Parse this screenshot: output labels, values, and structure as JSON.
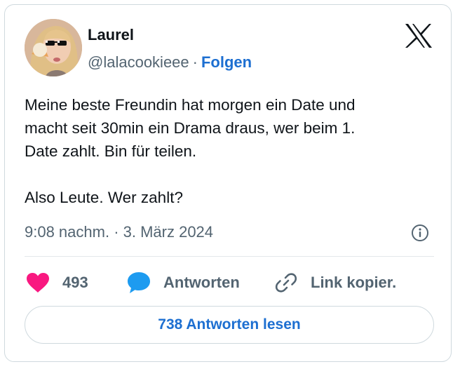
{
  "author": {
    "name": "Laurel",
    "handle": "@lalacookieee",
    "separator": "·",
    "follow_label": "Folgen"
  },
  "tweet": {
    "text": "Meine beste Freundin hat morgen ein Date und\nmacht seit 30min ein Drama draus, wer beim 1.\nDate zahlt. Bin für teilen.\n\nAlso Leute. Wer zahlt?",
    "timestamp": "9:08 nachm. · 3. März 2024"
  },
  "actions": {
    "like_count": "493",
    "reply_label": "Antworten",
    "copy_link_label": "Link kopier."
  },
  "read_replies_label": "738 Antworten lesen",
  "icons": {
    "brand": "x-logo-icon",
    "like": "heart-icon",
    "reply": "speech-bubble-icon",
    "copy": "link-icon",
    "info": "info-icon"
  },
  "colors": {
    "accent": "#1d6fd1",
    "like": "#f91880",
    "reply": "#1d9bf0",
    "muted": "#536471",
    "text": "#0f1419",
    "border": "#cfd9de"
  }
}
